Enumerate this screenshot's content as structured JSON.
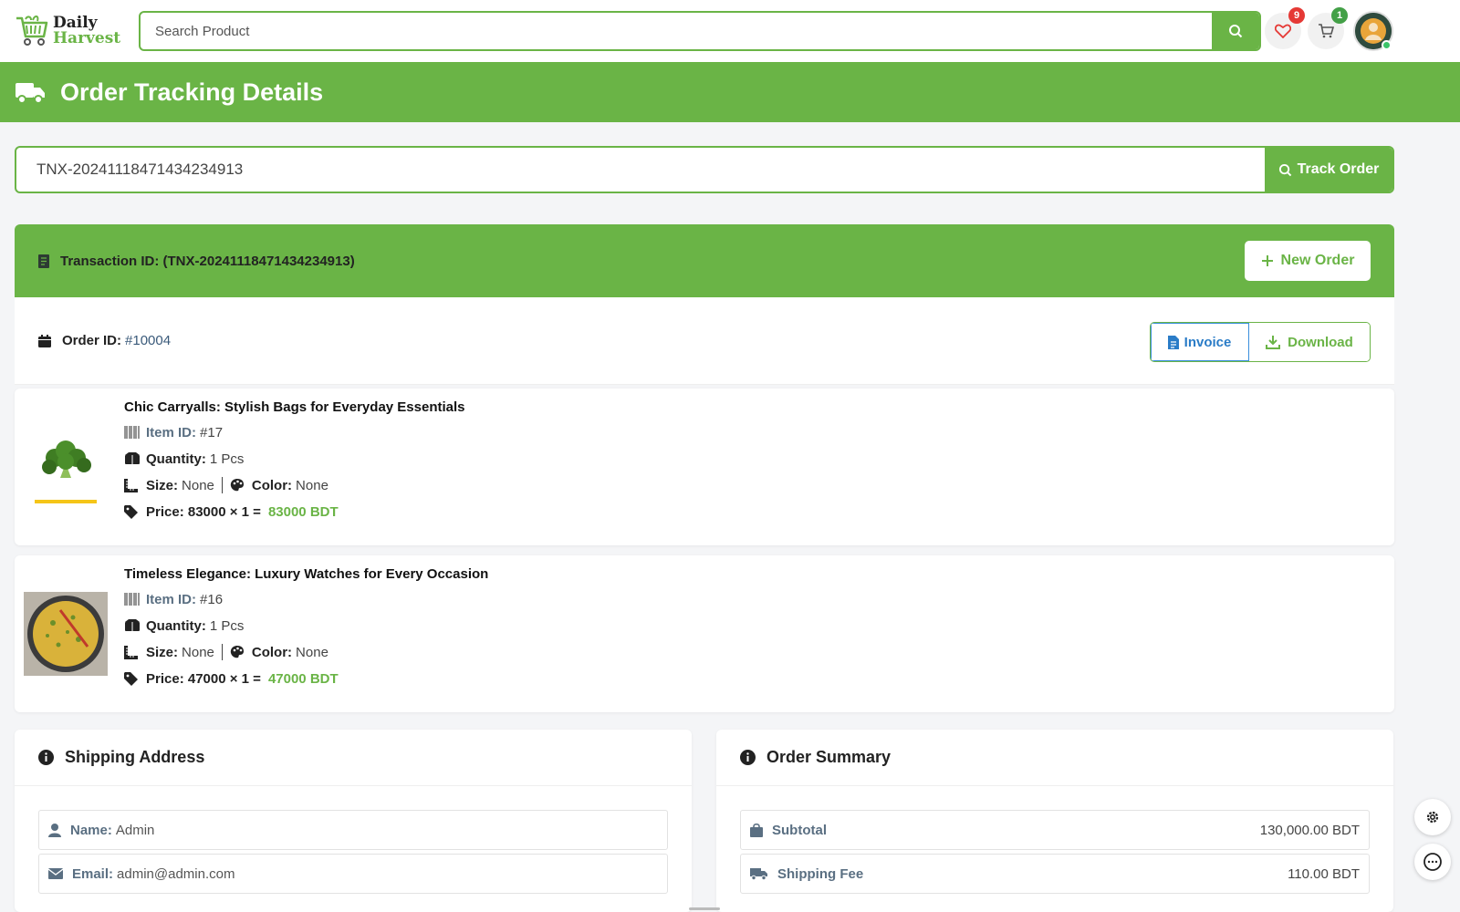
{
  "brand": {
    "line1": "Daily",
    "line2": "Harvest"
  },
  "search": {
    "placeholder": "Search Product"
  },
  "header_icons": {
    "wishlist_count": "9",
    "cart_count": "1",
    "wishlist_badge_color": "#e53935",
    "cart_badge_color": "#43a047"
  },
  "page": {
    "title": "Order Tracking Details"
  },
  "tracker": {
    "value": "TNX-20241118471434234913",
    "button_label": "Track Order"
  },
  "transaction": {
    "label": "Transaction ID: (TNX-20241118471434234913)",
    "new_order_label": "New Order"
  },
  "order": {
    "id_label": "Order ID:",
    "id_value": "#10004",
    "invoice_label": "Invoice",
    "download_label": "Download"
  },
  "items": [
    {
      "title": "Chic Carryalls: Stylish Bags for Everyday Essentials",
      "item_id_label": "Item ID:",
      "item_id": "#17",
      "quantity_label": "Quantity:",
      "quantity": "1 Pcs",
      "size_label": "Size:",
      "size": "None",
      "color_label": "Color:",
      "color": "None",
      "price_label": "Price: 83000 × 1 =",
      "price_total": "83000 BDT",
      "image": "broccoli"
    },
    {
      "title": "Timeless Elegance: Luxury Watches for Every Occasion",
      "item_id_label": "Item ID:",
      "item_id": "#16",
      "quantity_label": "Quantity:",
      "quantity": "1 Pcs",
      "size_label": "Size:",
      "size": "None",
      "color_label": "Color:",
      "color": "None",
      "price_label": "Price: 47000 × 1 =",
      "price_total": "47000 BDT",
      "image": "omelette"
    }
  ],
  "shipping": {
    "title": "Shipping Address",
    "name_label": "Name:",
    "name": "Admin",
    "email_label": "Email:",
    "email": "admin@admin.com"
  },
  "summary": {
    "title": "Order Summary",
    "subtotal_label": "Subtotal",
    "subtotal": "130,000.00 BDT",
    "shipping_label": "Shipping Fee",
    "shipping": "110.00 BDT"
  },
  "colors": {
    "brand_green": "#6ab446",
    "link_blue": "#2a7cc7"
  },
  "icons": [
    "cart-logo-icon",
    "search-icon",
    "heart-icon",
    "cart-icon",
    "avatar",
    "truck-icon",
    "receipt-icon",
    "calendar-icon",
    "file-icon",
    "download-icon",
    "plus-icon",
    "barcode-icon",
    "boxes-icon",
    "ruler-icon",
    "palette-icon",
    "tag-icon",
    "info-icon",
    "user-icon",
    "envelope-icon",
    "bag-icon",
    "gear-icon",
    "chat-icon"
  ]
}
